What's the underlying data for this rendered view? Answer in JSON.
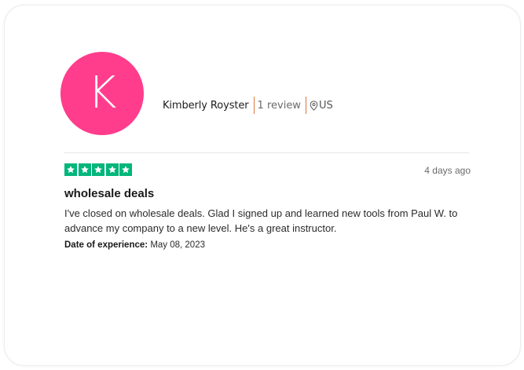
{
  "reviewer": {
    "initial": "K",
    "avatar_color": "#ff3d8c",
    "name": "Kimberly Royster",
    "review_count": "1 review",
    "country": "US"
  },
  "review": {
    "rating": 5,
    "max_rating": 5,
    "star_color": "#00b67a",
    "date_ago": "4 days ago",
    "title": "wholesale deals",
    "body": "I've closed on wholesale deals. Glad I signed up and learned new tools from Paul W. to advance my company to a new level. He's a great instructor.",
    "experience_label": "Date of experience:",
    "experience_date": "May 08, 2023"
  }
}
